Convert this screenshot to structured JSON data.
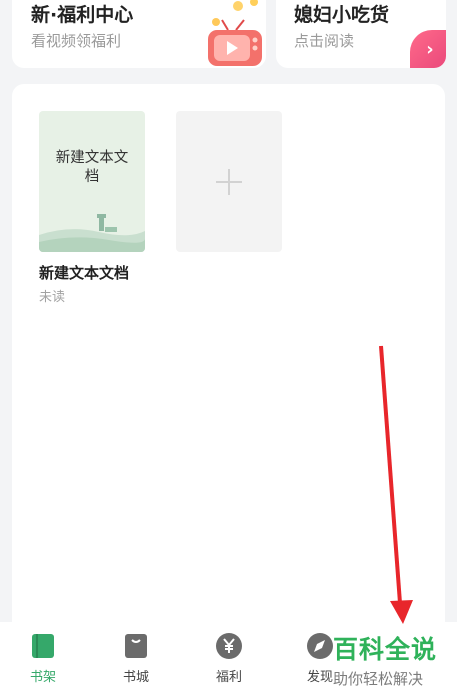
{
  "promo_cards": [
    {
      "title": "新·福利中心",
      "subtitle": "看视频领福利",
      "icon": "tv-icon"
    },
    {
      "title": "媳妇小吃货",
      "subtitle": "点击阅读",
      "badge": "›"
    }
  ],
  "bookshelf": {
    "books": [
      {
        "cover_title": "新建文本文档",
        "name": "新建文本文档",
        "status": "未读"
      }
    ],
    "add_symbol": "+"
  },
  "tabbar": {
    "tabs": [
      {
        "label": "书架",
        "icon": "bookshelf-icon",
        "active": true
      },
      {
        "label": "书城",
        "icon": "bookstore-icon",
        "active": false
      },
      {
        "label": "福利",
        "icon": "yen-coin-icon",
        "active": false
      },
      {
        "label": "发现",
        "icon": "compass-icon",
        "active": false
      }
    ]
  },
  "watermark": {
    "title": "百科全说",
    "subtitle": "助你轻松解决"
  },
  "colors": {
    "accent": "#35a86a",
    "watermark": "#2fb25a",
    "arrow": "#e8262b",
    "badge": "#e8467a"
  }
}
